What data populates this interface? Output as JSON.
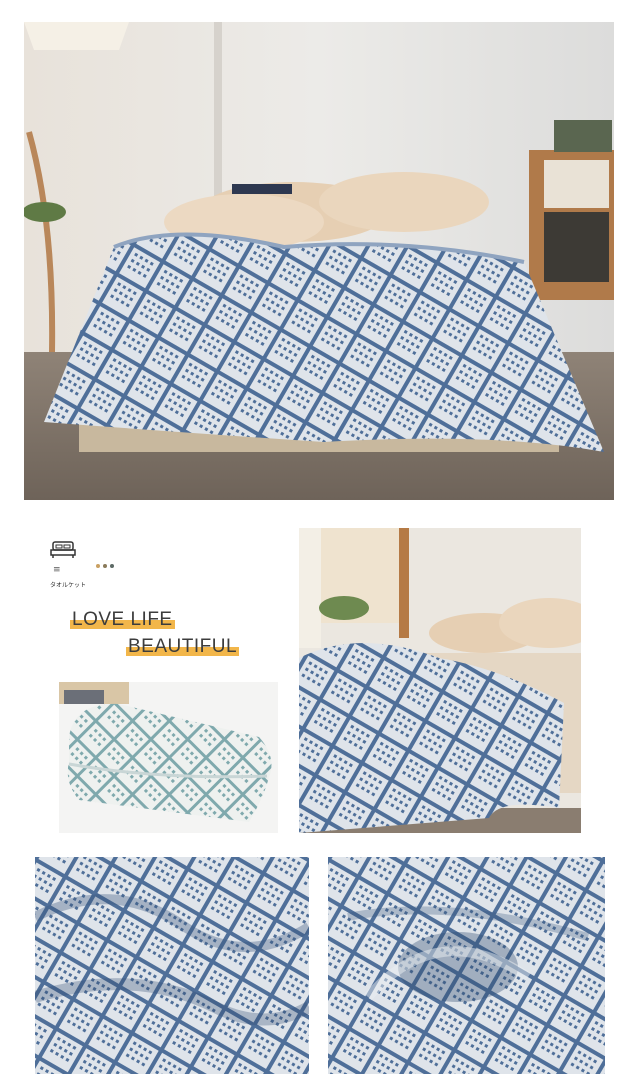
{
  "brand": {
    "name": "タオルケット",
    "menu_glyph": "≡",
    "dot_colors": [
      "#c9a062",
      "#8a7a5a",
      "#5d6a66"
    ]
  },
  "taglines": {
    "line1": "LOVE LIFE",
    "line2": "BEAUTIFUL",
    "highlight_color": "#f2b64a"
  },
  "palette": {
    "blanket_blue": "#4f6f99",
    "blanket_light": "#dfe4ea",
    "folded_teal": "#7fa9ad",
    "pillow": "#e6cfb3"
  },
  "photos": {
    "hero": "bedroom-scene-blue-geometric-blanket",
    "folded": "folded-teal-blanket",
    "bed2": "bed-corner-blue-blanket",
    "closeup1": "blanket-texture-closeup",
    "closeup2": "blanket-rumpled-closeup"
  }
}
